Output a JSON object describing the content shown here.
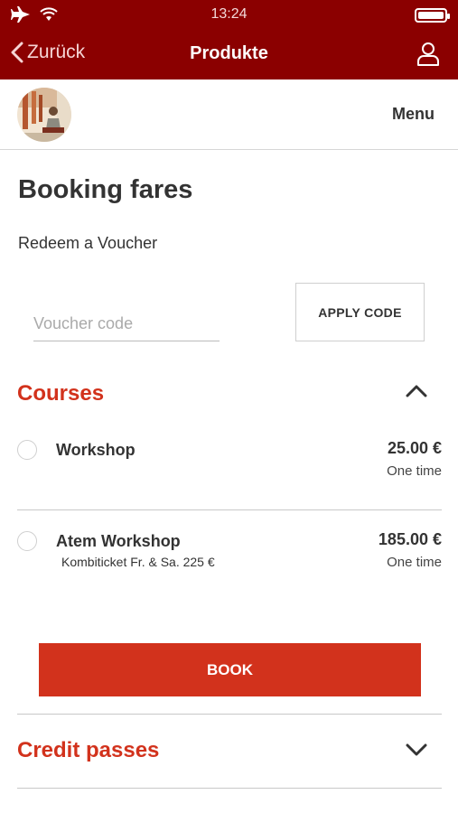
{
  "status_bar": {
    "time": "13:24"
  },
  "nav": {
    "back_label": "Zurück",
    "title": "Produkte"
  },
  "header": {
    "menu_label": "Menu"
  },
  "page": {
    "title": "Booking fares"
  },
  "voucher": {
    "label": "Redeem a Voucher",
    "placeholder": "Voucher code",
    "value": "",
    "apply_label": "APPLY CODE"
  },
  "courses": {
    "title": "Courses",
    "expanded": true,
    "items": [
      {
        "name": "Workshop",
        "description": "",
        "price": "25.00 €",
        "frequency": "One time"
      },
      {
        "name": "Atem Workshop",
        "description": "Kombiticket Fr. & Sa. 225 €",
        "price": "185.00 €",
        "frequency": "One time"
      }
    ],
    "book_label": "BOOK"
  },
  "credit_passes": {
    "title": "Credit passes",
    "expanded": false
  },
  "colors": {
    "header_bg": "#8b0000",
    "accent": "#d2321c"
  }
}
